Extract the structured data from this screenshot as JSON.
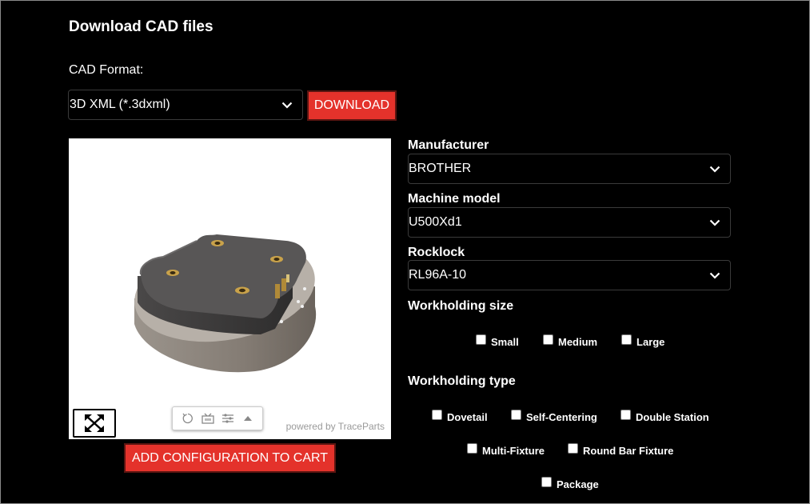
{
  "title": "Download CAD files",
  "cad_format": {
    "label": "CAD Format:",
    "selected": "3D XML (*.3dxml)"
  },
  "download_label": "DOWNLOAD",
  "viewer": {
    "powered_by": "powered by TraceParts",
    "toolbar_icons": [
      "rotate-icon",
      "view-camera-icon",
      "settings-sliders-icon",
      "caret-up-icon"
    ]
  },
  "cart_label": "ADD CONFIGURATION TO CART",
  "manufacturer": {
    "label": "Manufacturer",
    "selected": "BROTHER"
  },
  "machine_model": {
    "label": "Machine model",
    "selected": "U500Xd1"
  },
  "rocklock": {
    "label": "Rocklock",
    "selected": "RL96A-10"
  },
  "workholding_size": {
    "label": "Workholding size",
    "options": [
      "Small",
      "Medium",
      "Large"
    ]
  },
  "workholding_type": {
    "label": "Workholding type",
    "options": [
      "Dovetail",
      "Self-Centering",
      "Double Station",
      "Multi-Fixture",
      "Round Bar Fixture",
      "Package"
    ]
  },
  "colors": {
    "accent": "#e4322b",
    "background": "#000000"
  }
}
